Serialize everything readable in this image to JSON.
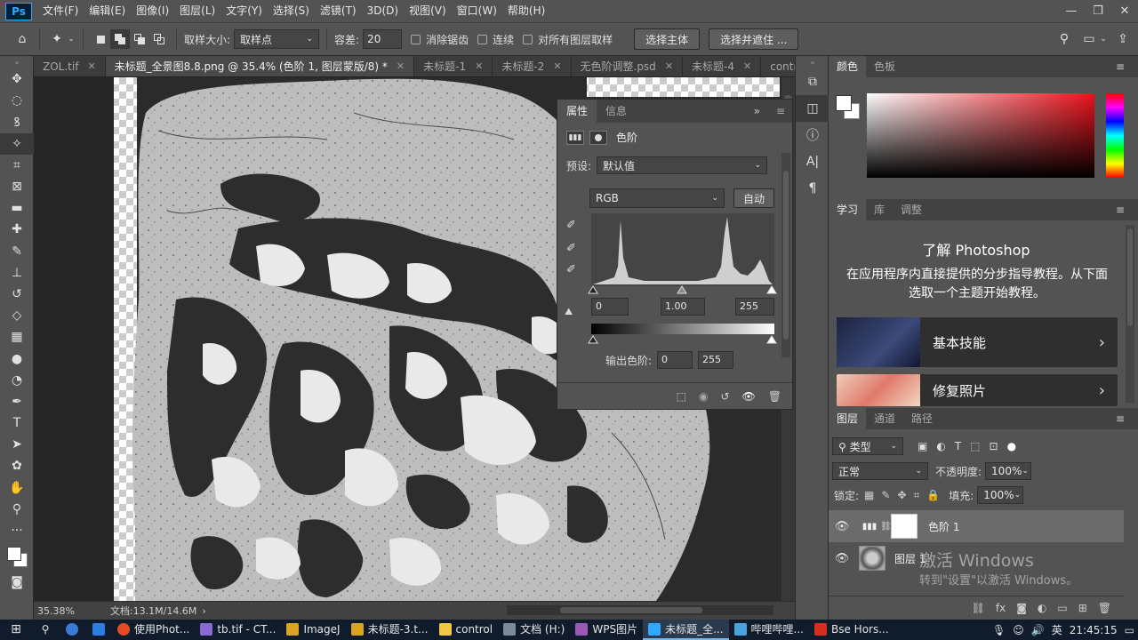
{
  "app": {
    "logo": "Ps",
    "menu": [
      "文件(F)",
      "编辑(E)",
      "图像(I)",
      "图层(L)",
      "文字(Y)",
      "选择(S)",
      "滤镜(T)",
      "3D(D)",
      "视图(V)",
      "窗口(W)",
      "帮助(H)"
    ],
    "window_controls": [
      "—",
      "❐",
      "✕"
    ]
  },
  "options_bar": {
    "sample_size_label": "取样大小:",
    "sample_size_value": "取样点",
    "tolerance_label": "容差:",
    "tolerance_value": "20",
    "anti_alias_label": "消除锯齿",
    "contiguous_label": "连续",
    "sample_all_layers_label": "对所有图层取样",
    "select_subject_label": "选择主体",
    "select_and_mask_label": "选择并遮住 ..."
  },
  "tabs": [
    {
      "label": "ZOL.tif",
      "active": false
    },
    {
      "label": "未标题_全景图8.8.png @ 35.4% (色阶 1, 图层蒙版/8) *",
      "active": true
    },
    {
      "label": "未标题-1",
      "active": false
    },
    {
      "label": "未标题-2",
      "active": false
    },
    {
      "label": "无色阶调整.psd",
      "active": false
    },
    {
      "label": "未标题-4",
      "active": false
    },
    {
      "label": "control_",
      "active": false
    }
  ],
  "status": {
    "zoom": "35.38%",
    "doc_info": "文档:13.1M/14.6M"
  },
  "properties": {
    "tab_properties": "属性",
    "tab_info": "信息",
    "adjustment_title": "色阶",
    "preset_label": "预设:",
    "preset_value": "默认值",
    "channel_value": "RGB",
    "auto_label": "自动",
    "input_black": "0",
    "input_gamma": "1.00",
    "input_white": "255",
    "output_label": "输出色阶:",
    "output_black": "0",
    "output_white": "255"
  },
  "color_panel": {
    "tab_color": "颜色",
    "tab_swatches": "色板",
    "hue_color": "#e8131b"
  },
  "learn_panel": {
    "tab_learn": "学习",
    "tab_library": "库",
    "tab_adjust": "调整",
    "title": "了解 Photoshop",
    "desc": "在应用程序内直接提供的分步指导教程。从下面选取一个主题开始教程。",
    "cards": [
      "基本技能",
      "修复照片"
    ]
  },
  "layers_panel": {
    "tab_layers": "图层",
    "tab_channels": "通道",
    "tab_paths": "路径",
    "filter_label": "类型",
    "blend_mode": "正常",
    "opacity_label": "不透明度:",
    "opacity_value": "100%",
    "lock_label": "锁定:",
    "fill_label": "填充:",
    "fill_value": "100%",
    "layers": [
      {
        "name": "色阶 1",
        "selected": true
      },
      {
        "name": "图层 1",
        "selected": false
      }
    ]
  },
  "watermark": {
    "title": "激活 Windows",
    "subtitle": "转到\"设置\"以激活 Windows。"
  },
  "taskbar": {
    "apps": [
      {
        "label": "使用Phot...",
        "color": "#e34c26",
        "active": false
      },
      {
        "label": "tb.tif - CT...",
        "color": "#8a6bd1",
        "active": false
      },
      {
        "label": "ImageJ",
        "color": "#d9a521",
        "active": false
      },
      {
        "label": "未标题-3.t...",
        "color": "#d9a521",
        "active": false
      },
      {
        "label": "control",
        "color": "#f2c744",
        "active": false
      },
      {
        "label": "文档 (H:)",
        "color": "#7d8a99",
        "active": false
      },
      {
        "label": "WPS图片",
        "color": "#9b59b6",
        "active": false
      },
      {
        "label": "未标题_全...",
        "color": "#31a8ff",
        "active": true
      },
      {
        "label": "哔哩哔哩...",
        "color": "#4aa3df",
        "active": false
      },
      {
        "label": "Bse Hors...",
        "color": "#d62d20",
        "active": false
      }
    ],
    "ime": "英",
    "time": "21:45:15"
  }
}
